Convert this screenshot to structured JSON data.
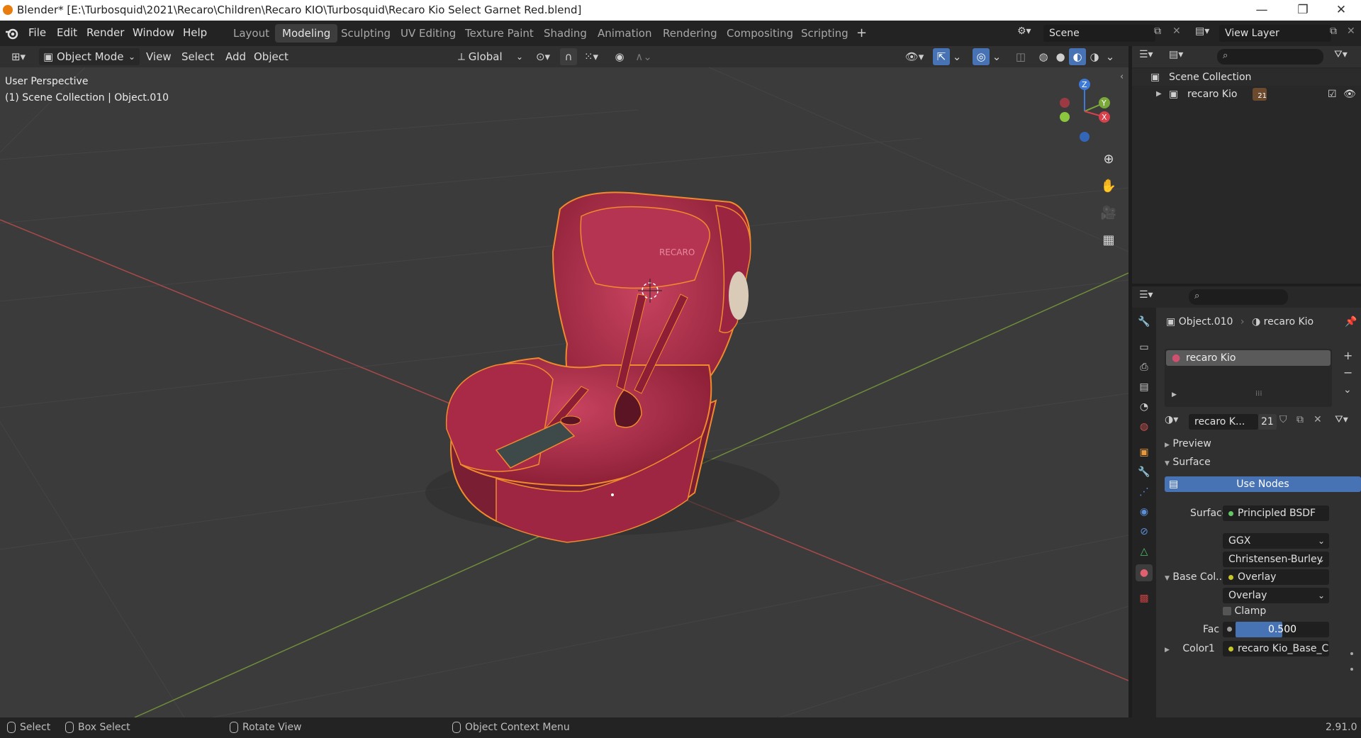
{
  "window": {
    "title": "Blender* [E:\\Turbosquid\\2021\\Recaro\\Children\\Recaro KIO\\Turbosquid\\Recaro Kio Select Garnet Red.blend]",
    "minimize": "—",
    "maximize": "❐",
    "close": "✕"
  },
  "menu": {
    "items": [
      "File",
      "Edit",
      "Render",
      "Window",
      "Help"
    ]
  },
  "workspaces": {
    "tabs": [
      "Layout",
      "Modeling",
      "Sculpting",
      "UV Editing",
      "Texture Paint",
      "Shading",
      "Animation",
      "Rendering",
      "Compositing",
      "Scripting"
    ],
    "active": "Modeling",
    "add": "+"
  },
  "scene": {
    "name": "Scene",
    "view_layer": "View Layer"
  },
  "viewport_header": {
    "mode": "Object Mode",
    "view": "View",
    "select": "Select",
    "add": "Add",
    "object": "Object",
    "orientation": "Global"
  },
  "viewport": {
    "perspective": "User Perspective",
    "context": "(1) Scene Collection | Object.010",
    "gizmo": {
      "z": "Z",
      "y": "Y",
      "x": "X"
    },
    "seat_logo": "RECARO"
  },
  "outliner": {
    "root": "Scene Collection",
    "items": [
      {
        "label": "recaro Kio",
        "badge": "21"
      }
    ]
  },
  "properties": {
    "breadcrumb_object": "Object.010",
    "breadcrumb_material": "recaro Kio",
    "material_slot": "recaro Kio",
    "material_name": "recaro K...",
    "users": "21",
    "preview": "Preview",
    "surface_panel": "Surface",
    "use_nodes": "Use Nodes",
    "surface_label": "Surface",
    "surface_value": "Principled BSDF",
    "distribution": "GGX",
    "subsurface": "Christensen-Burley",
    "base_color_label": "Base Col...",
    "base_color_value": "Overlay",
    "blend_mode": "Overlay",
    "clamp": "Clamp",
    "fac_label": "Fac",
    "fac_value": "0.500",
    "fac_fraction": 0.5,
    "color1_label": "Color1",
    "color1_value": "recaro Kio_Base_C"
  },
  "status": {
    "select": "Select",
    "box_select": "Box Select",
    "rotate_view": "Rotate View",
    "context_menu": "Object Context Menu",
    "version": "2.91.0"
  },
  "colors": {
    "accent": "#4772b3",
    "selection_outline": "#f08a2c",
    "seat": "#b8324f"
  }
}
